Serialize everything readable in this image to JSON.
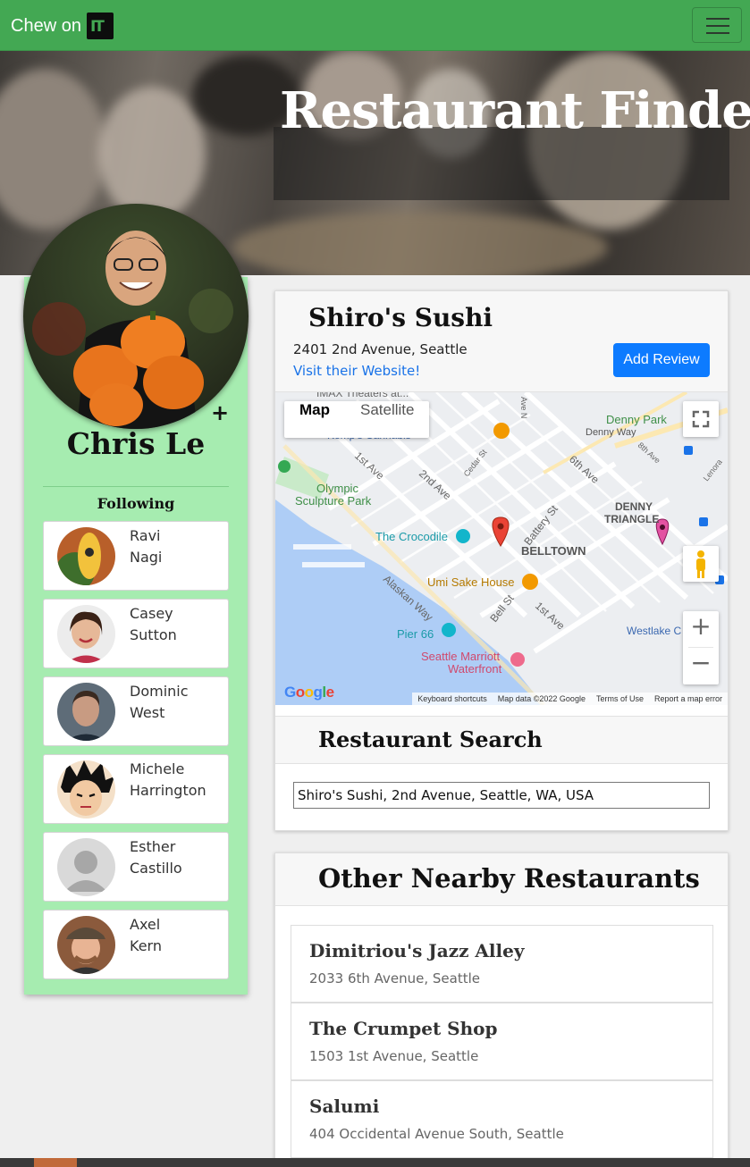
{
  "navbar": {
    "brand": "Chew on",
    "logo_text": "IT",
    "menu_icon": "hamburger-icon"
  },
  "hero": {
    "title": "Restaurant Finder"
  },
  "profile": {
    "name": "Chris Le",
    "follow_icon": "plus-icon",
    "following_label": "Following",
    "following": [
      {
        "first": "Ravi",
        "last": "Nagi"
      },
      {
        "first": "Casey",
        "last": "Sutton"
      },
      {
        "first": "Dominic",
        "last": "West"
      },
      {
        "first": "Michele",
        "last": "Harrington"
      },
      {
        "first": "Esther",
        "last": "Castillo"
      },
      {
        "first": "Axel",
        "last": "Kern"
      }
    ]
  },
  "restaurant": {
    "name": "Shiro's Sushi",
    "address": "2401 2nd Avenue, Seattle",
    "website_link": "Visit their Website!",
    "add_review_label": "Add Review"
  },
  "map": {
    "type_map": "Map",
    "type_satellite": "Satellite",
    "logo": "Google",
    "footer": {
      "shortcuts": "Keyboard shortcuts",
      "data": "Map data ©2022 Google",
      "terms": "Terms of Use",
      "report": "Report a map error"
    },
    "labels": {
      "imax": "IMAX Theaters at...",
      "kempo": "Kemp's Cannabis",
      "denny_park": "Denny Park",
      "denny_way": "Denny Way",
      "olympic1": "Olympic",
      "olympic2": "Sculpture Park",
      "denny_tri1": "DENNY",
      "denny_tri2": "TRIANGLE",
      "crocodile": "The Crocodile",
      "belltown": "BELLTOWN",
      "umi": "Umi Sake House",
      "pier66": "Pier 66",
      "marriott1": "Seattle Marriott",
      "marriott2": "Waterfront",
      "westlake": "Westlake C",
      "first_ave": "1st Ave",
      "second_ave": "2nd Ave",
      "sixth_ave": "6th Ave",
      "eighth_ave": "8th Ave",
      "alaskan": "Alaskan Way",
      "bell_st": "Bell St",
      "battery_st": "Battery St",
      "cedar_st": "Cedar St",
      "lenora": "Lenora",
      "first_ave_2": "1st Ave",
      "ave_n": "Ave N"
    }
  },
  "search": {
    "title": "Restaurant Search",
    "value": "Shiro's Sushi, 2nd Avenue, Seattle, WA, USA"
  },
  "nearby": {
    "title": "Other Nearby Restaurants",
    "items": [
      {
        "name": "Dimitriou's Jazz Alley",
        "address": "2033 6th Avenue, Seattle"
      },
      {
        "name": "The Crumpet Shop",
        "address": "1503 1st Avenue, Seattle"
      },
      {
        "name": "Salumi",
        "address": "404 Occidental Avenue South, Seattle"
      }
    ]
  }
}
